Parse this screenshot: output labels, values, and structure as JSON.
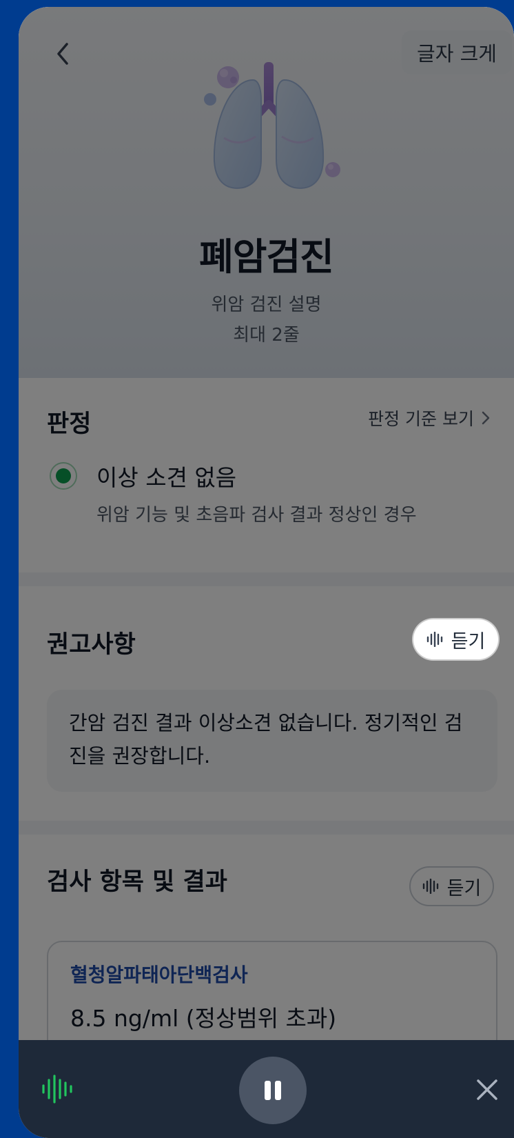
{
  "header": {
    "font_size_label": "글자 크게",
    "title": "폐암검진",
    "description_line1": "위암 검진 설명",
    "description_line2": "최대 2줄"
  },
  "verdict": {
    "title": "판정",
    "criteria_link": "판정 기준 보기",
    "result_label": "이상 소견 없음",
    "result_description": "위암 기능 및 초음파 검사 결과 정상인 경우",
    "selected": true
  },
  "recommendation": {
    "title": "권고사항",
    "listen_label": "듣기",
    "text": "간암 검진 결과 이상소견 없습니다. 정기적인 검진을 권장합니다."
  },
  "tests": {
    "title": "검사 항목 및 결과",
    "listen_label": "듣기",
    "items": [
      {
        "name": "혈청알파태아단백검사",
        "value": "8.5 ng/ml (정상범위 초과)"
      }
    ]
  },
  "player": {
    "state": "playing",
    "colors": {
      "wave": "#22c55e",
      "background": "#1e2939"
    }
  },
  "colors": {
    "accent_blue": "#1f4aa8",
    "status_green": "#0d9f4f",
    "frame_blue": "#003c8f"
  }
}
